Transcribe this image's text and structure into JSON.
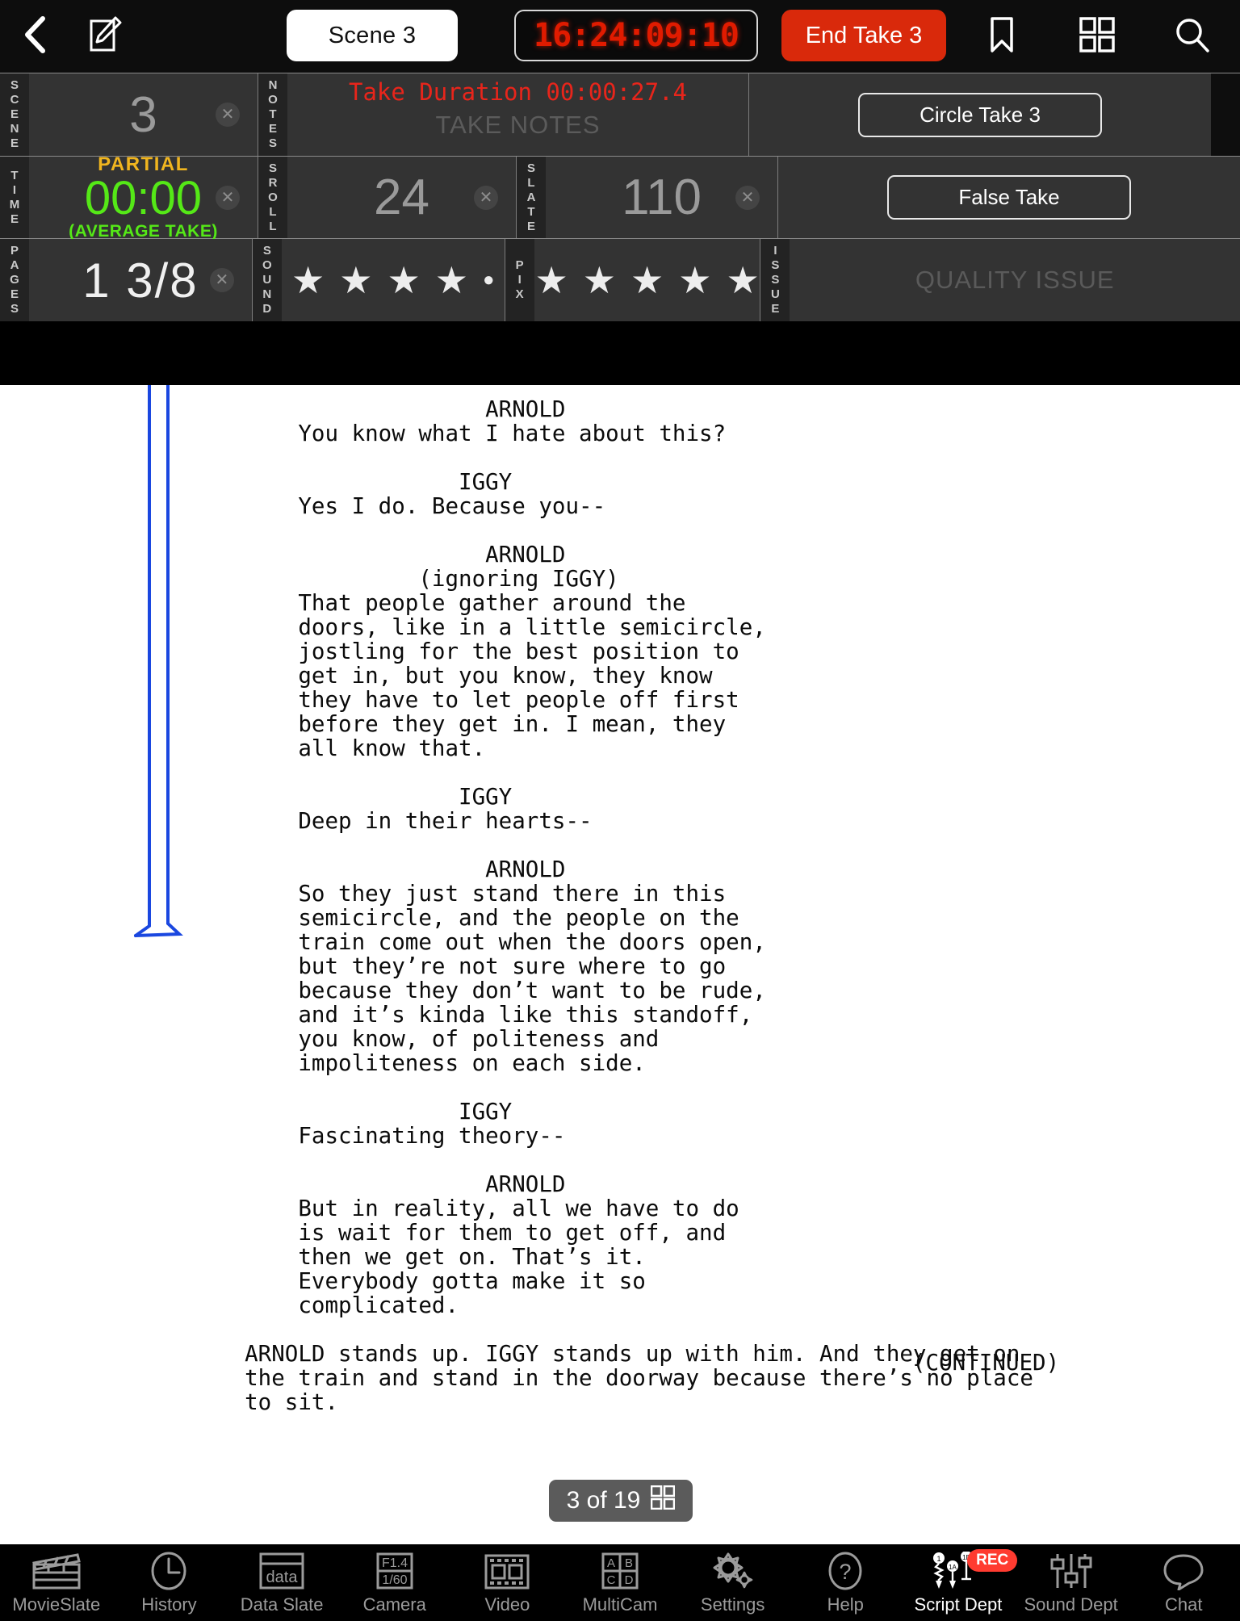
{
  "topbar": {
    "back_icon": "chevron-left-icon",
    "edit_icon": "pencil-note-icon",
    "scene_label": "Scene 3",
    "timecode": "16:24:09:10",
    "end_take_label": "End Take 3",
    "bookmark_icon": "bookmark-icon",
    "grid_icon": "grid-icon",
    "search_icon": "search-icon",
    "accent_red": "#d9290b"
  },
  "slate": {
    "scene": {
      "label": "SCENE",
      "value": "3"
    },
    "notes": {
      "label": "NOTES",
      "take_duration": "Take Duration 00:00:27.4",
      "placeholder": "TAKE NOTES",
      "duration_color": "#e8251b"
    },
    "time": {
      "label": "TIME",
      "status": "PARTIAL",
      "value": "00:00",
      "sub": "(AVERAGE TAKE)",
      "status_color": "#f0b51f",
      "value_color": "#55e817"
    },
    "sroll": {
      "label": "SROLL",
      "value": "24"
    },
    "slate_no": {
      "label": "SLATE",
      "value": "110"
    },
    "pages": {
      "label": "PAGES",
      "value": "1 3/8"
    },
    "sound": {
      "label": "SOUND",
      "rating": 4,
      "max": 5
    },
    "pix": {
      "label": "PIX",
      "rating": 5,
      "max": 5
    },
    "issue": {
      "label": "ISSUE",
      "placeholder": "QUALITY ISSUE"
    },
    "actions": {
      "circle_take": "Circle Take 3",
      "false_take": "False Take"
    }
  },
  "script_page": {
    "body": "                    ARNOLD\n      You know what I hate about this?\n\n                  IGGY\n      Yes I do. Because you--\n\n                    ARNOLD\n               (ignoring IGGY)\n      That people gather around the\n      doors, like in a little semicircle,\n      jostling for the best position to\n      get in, but you know, they know\n      they have to let people off first\n      before they get in. I mean, they\n      all know that.\n\n                  IGGY\n      Deep in their hearts--\n\n                    ARNOLD\n      So they just stand there in this\n      semicircle, and the people on the\n      train come out when the doors open,\n      but they’re not sure where to go\n      because they don’t want to be rude,\n      and it’s kinda like this standoff,\n      you know, of politeness and\n      impoliteness on each side.\n\n                  IGGY\n      Fascinating theory--\n\n                    ARNOLD\n      But in reality, all we have to do\n      is wait for them to get off, and\n      then we get on. That’s it.\n      Everybody gotta make it so\n      complicated.\n\n  ARNOLD stands up. IGGY stands up with him. And they get on\n  the train and stand in the doorway because there’s no place\n  to sit.",
    "continued": "(CONTINUED)",
    "annotation_color": "#1a47e0",
    "page_indicator": "3 of 19",
    "page_grid_icon": "grid-icon"
  },
  "tabbar": {
    "items": [
      {
        "label": "MovieSlate",
        "icon": "clapperboard-icon",
        "active": false
      },
      {
        "label": "History",
        "icon": "clock-icon",
        "active": false
      },
      {
        "label": "Data Slate",
        "icon": "data-slate-icon",
        "active": false
      },
      {
        "label": "Camera",
        "icon": "camera-settings-icon",
        "active": false
      },
      {
        "label": "Video",
        "icon": "film-strip-icon",
        "active": false
      },
      {
        "label": "MultiCam",
        "icon": "multicam-grid-icon",
        "active": false
      },
      {
        "label": "Settings",
        "icon": "gears-icon",
        "active": false
      },
      {
        "label": "Help",
        "icon": "question-mark-icon",
        "active": false
      },
      {
        "label": "Script Dept",
        "icon": "script-marks-icon",
        "active": true,
        "badge": "REC"
      },
      {
        "label": "Sound Dept",
        "icon": "mixer-faders-icon",
        "active": false
      },
      {
        "label": "Chat",
        "icon": "chat-bubble-icon",
        "active": false
      }
    ],
    "badge_color": "#ff3b30"
  }
}
